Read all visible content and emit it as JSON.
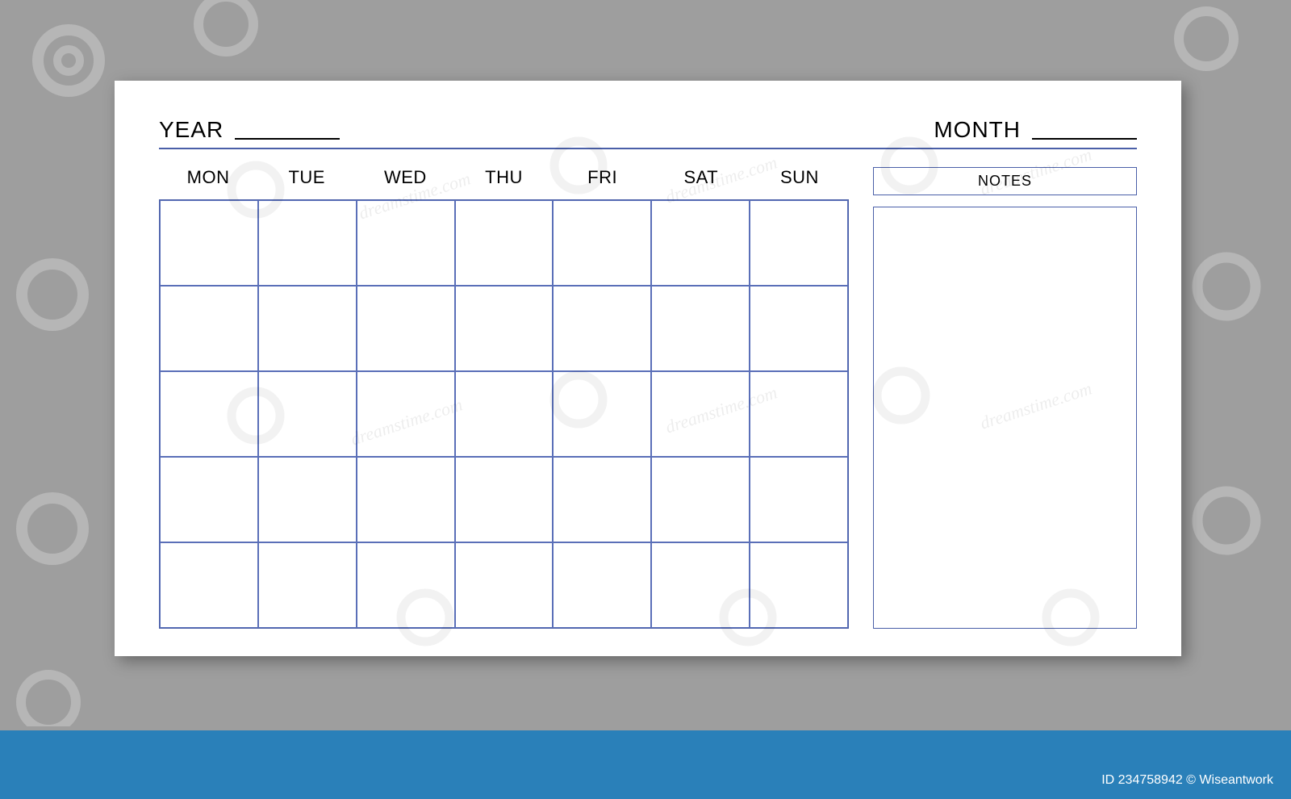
{
  "header": {
    "year_label": "YEAR",
    "month_label": "MONTH"
  },
  "calendar": {
    "days": [
      "MON",
      "TUE",
      "WED",
      "THU",
      "FRI",
      "SAT",
      "SUN"
    ],
    "rows": 5
  },
  "notes": {
    "title": "NOTES"
  },
  "attribution": {
    "id_label": "ID 234758942 © Wiseantwork"
  },
  "watermark": {
    "text": "dreamstime.com"
  }
}
